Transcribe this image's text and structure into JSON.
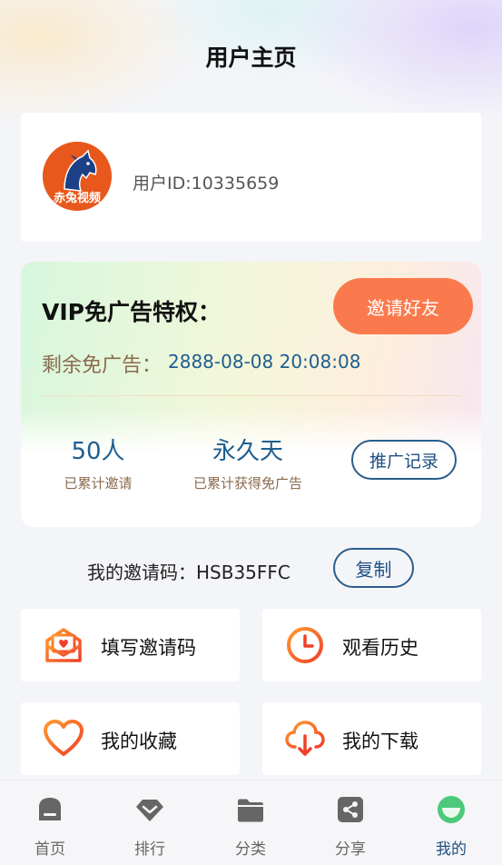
{
  "header": {
    "title": "用户主页"
  },
  "user": {
    "avatar_text": "赤兔视频",
    "id_text": "用户ID:10335659"
  },
  "vip": {
    "title": "VIP免广告特权：",
    "invite_button": "邀请好友",
    "remaining_label": "剩余免广告：",
    "remaining_value": "2888-08-08 20:08:08",
    "stats": [
      {
        "value": "50人",
        "label": "已累计邀请"
      },
      {
        "value": "永久天",
        "label": "已累计获得免广告"
      }
    ],
    "promo_button": "推广记录"
  },
  "invite_code": {
    "label": "我的邀请码：HSB35FFC",
    "copy_button": "复制"
  },
  "menu": [
    {
      "label": "填写邀请码",
      "icon": "envelope-heart-icon"
    },
    {
      "label": "观看历史",
      "icon": "clock-icon"
    },
    {
      "label": "我的收藏",
      "icon": "heart-icon"
    },
    {
      "label": "我的下载",
      "icon": "cloud-download-icon"
    }
  ],
  "tabbar": {
    "items": [
      {
        "label": "首页",
        "icon": "home-icon"
      },
      {
        "label": "排行",
        "icon": "diamond-icon"
      },
      {
        "label": "分类",
        "icon": "folder-icon"
      },
      {
        "label": "分享",
        "icon": "share-icon"
      },
      {
        "label": "我的",
        "icon": "face-icon"
      }
    ],
    "active_index": 4
  },
  "colors": {
    "accent": "#fb7a4d",
    "link_blue": "#1e5e8f",
    "active_tab": "#4cc97a"
  }
}
